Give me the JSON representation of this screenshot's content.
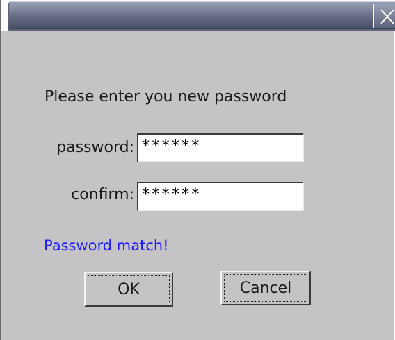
{
  "titlebar": {
    "close_icon": "close-x-icon"
  },
  "dialog": {
    "prompt": "Please enter you new password",
    "password_label": "password:",
    "password_value": "******",
    "confirm_label": "confirm:",
    "confirm_value": "******",
    "status_text": "Password match!",
    "status_color": "#1a1aff",
    "ok_label": "OK",
    "cancel_label": "Cancel"
  }
}
